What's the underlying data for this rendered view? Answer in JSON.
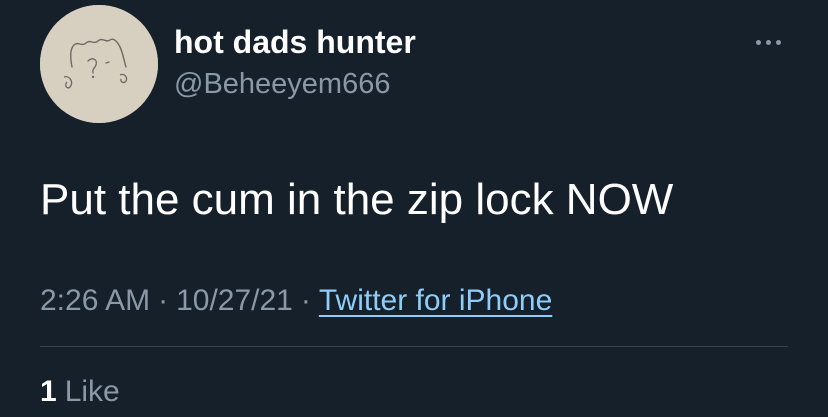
{
  "colors": {
    "background": "#15202b",
    "primary_text": "#ffffff",
    "secondary_text": "#8b98a5",
    "link": "#8ecdf8",
    "divider": "#38444d",
    "avatar_bg": "#d7cfc0"
  },
  "author": {
    "display_name": "hot dads hunter",
    "handle": "@Beheeyem666",
    "avatar_icon": "doodle-face-avatar"
  },
  "more_icon": "more-horizontal-icon",
  "tweet": {
    "text": "Put the cum in the zip lock NOW"
  },
  "meta": {
    "time": "2:26 AM",
    "separator": "·",
    "date": "10/27/21",
    "source": "Twitter for iPhone"
  },
  "engagement": {
    "like_count": "1",
    "like_label": "Like"
  }
}
